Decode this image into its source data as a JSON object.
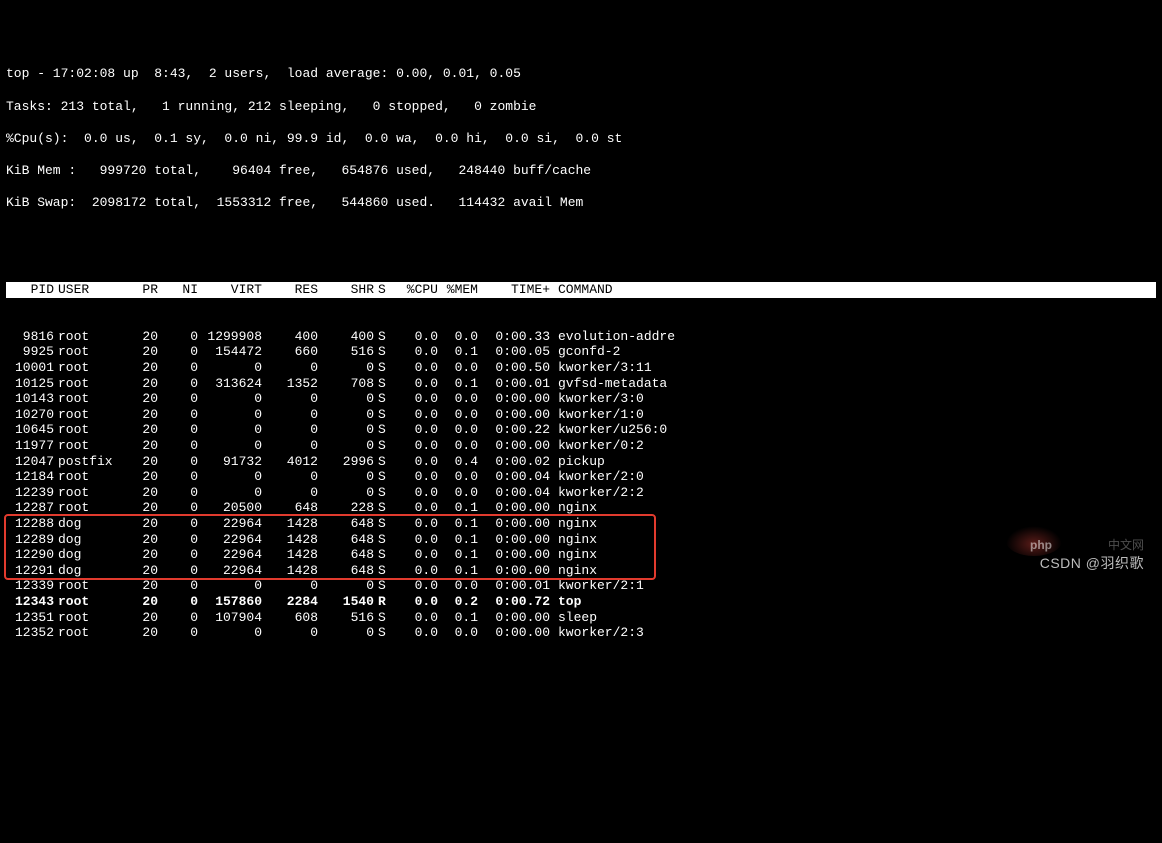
{
  "summary": {
    "line1": "top - 17:02:08 up  8:43,  2 users,  load average: 0.00, 0.01, 0.05",
    "line2": "Tasks: 213 total,   1 running, 212 sleeping,   0 stopped,   0 zombie",
    "line3": "%Cpu(s):  0.0 us,  0.1 sy,  0.0 ni, 99.9 id,  0.0 wa,  0.0 hi,  0.0 si,  0.0 st",
    "line4": "KiB Mem :   999720 total,    96404 free,   654876 used,   248440 buff/cache",
    "line5": "KiB Swap:  2098172 total,  1553312 free,   544860 used.   114432 avail Mem"
  },
  "columns": {
    "pid": "PID",
    "user": "USER",
    "pr": "PR",
    "ni": "NI",
    "virt": "VIRT",
    "res": "RES",
    "shr": "SHR",
    "s": "S",
    "cpu": "%CPU",
    "mem": "%MEM",
    "time": "TIME+",
    "cmd": "COMMAND"
  },
  "processes": [
    {
      "pid": "9816",
      "user": "root",
      "pr": "20",
      "ni": "0",
      "virt": "1299908",
      "res": "400",
      "shr": "400",
      "s": "S",
      "cpu": "0.0",
      "mem": "0.0",
      "time": "0:00.33",
      "cmd": "evolution-addre",
      "bold": false,
      "hl": false
    },
    {
      "pid": "9925",
      "user": "root",
      "pr": "20",
      "ni": "0",
      "virt": "154472",
      "res": "660",
      "shr": "516",
      "s": "S",
      "cpu": "0.0",
      "mem": "0.1",
      "time": "0:00.05",
      "cmd": "gconfd-2",
      "bold": false,
      "hl": false
    },
    {
      "pid": "10001",
      "user": "root",
      "pr": "20",
      "ni": "0",
      "virt": "0",
      "res": "0",
      "shr": "0",
      "s": "S",
      "cpu": "0.0",
      "mem": "0.0",
      "time": "0:00.50",
      "cmd": "kworker/3:11",
      "bold": false,
      "hl": false
    },
    {
      "pid": "10125",
      "user": "root",
      "pr": "20",
      "ni": "0",
      "virt": "313624",
      "res": "1352",
      "shr": "708",
      "s": "S",
      "cpu": "0.0",
      "mem": "0.1",
      "time": "0:00.01",
      "cmd": "gvfsd-metadata",
      "bold": false,
      "hl": false
    },
    {
      "pid": "10143",
      "user": "root",
      "pr": "20",
      "ni": "0",
      "virt": "0",
      "res": "0",
      "shr": "0",
      "s": "S",
      "cpu": "0.0",
      "mem": "0.0",
      "time": "0:00.00",
      "cmd": "kworker/3:0",
      "bold": false,
      "hl": false
    },
    {
      "pid": "10270",
      "user": "root",
      "pr": "20",
      "ni": "0",
      "virt": "0",
      "res": "0",
      "shr": "0",
      "s": "S",
      "cpu": "0.0",
      "mem": "0.0",
      "time": "0:00.00",
      "cmd": "kworker/1:0",
      "bold": false,
      "hl": false
    },
    {
      "pid": "10645",
      "user": "root",
      "pr": "20",
      "ni": "0",
      "virt": "0",
      "res": "0",
      "shr": "0",
      "s": "S",
      "cpu": "0.0",
      "mem": "0.0",
      "time": "0:00.22",
      "cmd": "kworker/u256:0",
      "bold": false,
      "hl": false
    },
    {
      "pid": "11977",
      "user": "root",
      "pr": "20",
      "ni": "0",
      "virt": "0",
      "res": "0",
      "shr": "0",
      "s": "S",
      "cpu": "0.0",
      "mem": "0.0",
      "time": "0:00.00",
      "cmd": "kworker/0:2",
      "bold": false,
      "hl": false
    },
    {
      "pid": "12047",
      "user": "postfix",
      "pr": "20",
      "ni": "0",
      "virt": "91732",
      "res": "4012",
      "shr": "2996",
      "s": "S",
      "cpu": "0.0",
      "mem": "0.4",
      "time": "0:00.02",
      "cmd": "pickup",
      "bold": false,
      "hl": false
    },
    {
      "pid": "12184",
      "user": "root",
      "pr": "20",
      "ni": "0",
      "virt": "0",
      "res": "0",
      "shr": "0",
      "s": "S",
      "cpu": "0.0",
      "mem": "0.0",
      "time": "0:00.04",
      "cmd": "kworker/2:0",
      "bold": false,
      "hl": false
    },
    {
      "pid": "12239",
      "user": "root",
      "pr": "20",
      "ni": "0",
      "virt": "0",
      "res": "0",
      "shr": "0",
      "s": "S",
      "cpu": "0.0",
      "mem": "0.0",
      "time": "0:00.04",
      "cmd": "kworker/2:2",
      "bold": false,
      "hl": false
    },
    {
      "pid": "12287",
      "user": "root",
      "pr": "20",
      "ni": "0",
      "virt": "20500",
      "res": "648",
      "shr": "228",
      "s": "S",
      "cpu": "0.0",
      "mem": "0.1",
      "time": "0:00.00",
      "cmd": "nginx",
      "bold": false,
      "hl": false
    },
    {
      "pid": "12288",
      "user": "dog",
      "pr": "20",
      "ni": "0",
      "virt": "22964",
      "res": "1428",
      "shr": "648",
      "s": "S",
      "cpu": "0.0",
      "mem": "0.1",
      "time": "0:00.00",
      "cmd": "nginx",
      "bold": false,
      "hl": true
    },
    {
      "pid": "12289",
      "user": "dog",
      "pr": "20",
      "ni": "0",
      "virt": "22964",
      "res": "1428",
      "shr": "648",
      "s": "S",
      "cpu": "0.0",
      "mem": "0.1",
      "time": "0:00.00",
      "cmd": "nginx",
      "bold": false,
      "hl": true
    },
    {
      "pid": "12290",
      "user": "dog",
      "pr": "20",
      "ni": "0",
      "virt": "22964",
      "res": "1428",
      "shr": "648",
      "s": "S",
      "cpu": "0.0",
      "mem": "0.1",
      "time": "0:00.00",
      "cmd": "nginx",
      "bold": false,
      "hl": true
    },
    {
      "pid": "12291",
      "user": "dog",
      "pr": "20",
      "ni": "0",
      "virt": "22964",
      "res": "1428",
      "shr": "648",
      "s": "S",
      "cpu": "0.0",
      "mem": "0.1",
      "time": "0:00.00",
      "cmd": "nginx",
      "bold": false,
      "hl": true
    },
    {
      "pid": "12339",
      "user": "root",
      "pr": "20",
      "ni": "0",
      "virt": "0",
      "res": "0",
      "shr": "0",
      "s": "S",
      "cpu": "0.0",
      "mem": "0.0",
      "time": "0:00.01",
      "cmd": "kworker/2:1",
      "bold": false,
      "hl": false
    },
    {
      "pid": "12343",
      "user": "root",
      "pr": "20",
      "ni": "0",
      "virt": "157860",
      "res": "2284",
      "shr": "1540",
      "s": "R",
      "cpu": "0.0",
      "mem": "0.2",
      "time": "0:00.72",
      "cmd": "top",
      "bold": true,
      "hl": false
    },
    {
      "pid": "12351",
      "user": "root",
      "pr": "20",
      "ni": "0",
      "virt": "107904",
      "res": "608",
      "shr": "516",
      "s": "S",
      "cpu": "0.0",
      "mem": "0.1",
      "time": "0:00.00",
      "cmd": "sleep",
      "bold": false,
      "hl": false
    },
    {
      "pid": "12352",
      "user": "root",
      "pr": "20",
      "ni": "0",
      "virt": "0",
      "res": "0",
      "shr": "0",
      "s": "S",
      "cpu": "0.0",
      "mem": "0.0",
      "time": "0:00.00",
      "cmd": "kworker/2:3",
      "bold": false,
      "hl": false
    }
  ],
  "watermark": "CSDN @羽织歌",
  "phpLogo": "php",
  "cnText": "中文网"
}
